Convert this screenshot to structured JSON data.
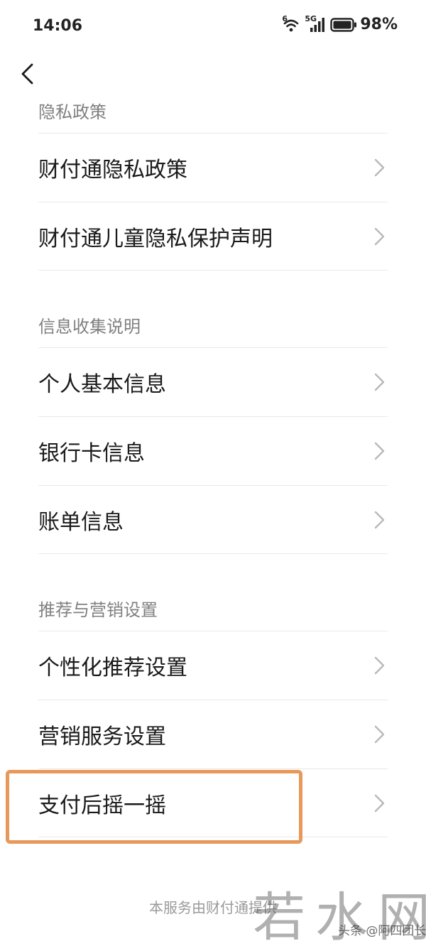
{
  "status_bar": {
    "time": "14:06",
    "wifi_badge": "6",
    "cellular_badge": "5G",
    "battery": "98%"
  },
  "nav": {
    "back_icon": "chevron-left-icon"
  },
  "sections": [
    {
      "label": "隐私政策",
      "items": [
        {
          "label": "财付通隐私政策"
        },
        {
          "label": "财付通儿童隐私保护声明"
        }
      ]
    },
    {
      "label": "信息收集说明",
      "items": [
        {
          "label": "个人基本信息"
        },
        {
          "label": "银行卡信息"
        },
        {
          "label": "账单信息"
        }
      ]
    },
    {
      "label": "推荐与营销设置",
      "items": [
        {
          "label": "个性化推荐设置"
        },
        {
          "label": "营销服务设置"
        },
        {
          "label": "支付后摇一摇"
        }
      ]
    }
  ],
  "footer": {
    "note": "本服务由财付通提供"
  },
  "watermark": {
    "site": "若水网",
    "credit": "头条 @阿四团长"
  },
  "colors": {
    "highlight": "#e8995a",
    "section_text": "#808080",
    "divider": "#e9e9e9"
  }
}
